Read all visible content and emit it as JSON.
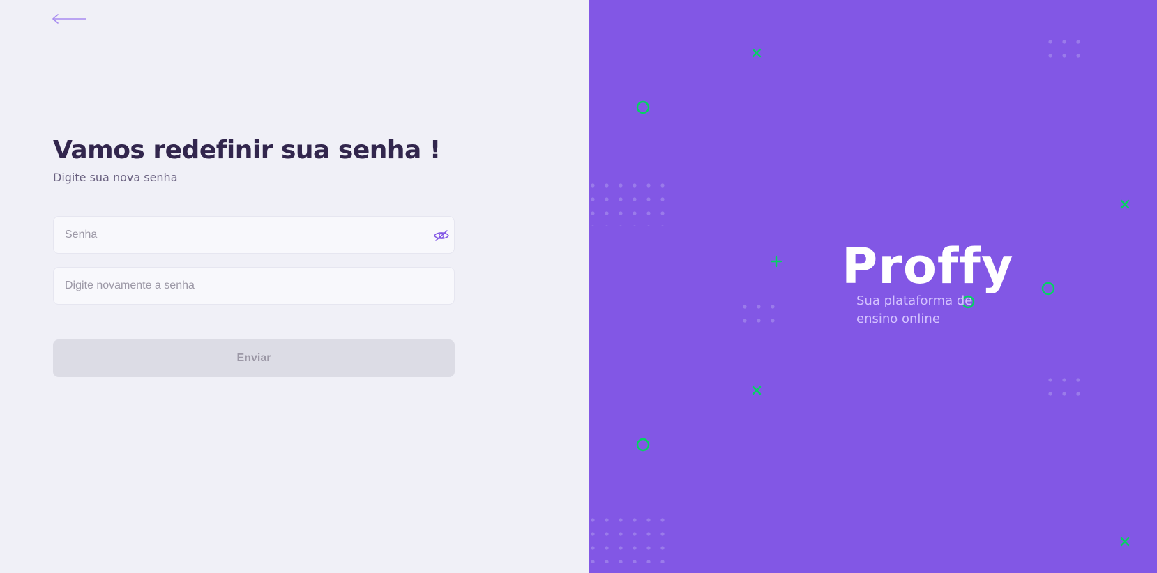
{
  "form": {
    "title": "Vamos redefinir sua senha !",
    "subtitle": "Digite sua nova senha",
    "password_placeholder": "Senha",
    "password_value": "",
    "confirm_placeholder": "Digite novamente a senha",
    "confirm_value": "",
    "submit_label": "Enviar",
    "back_icon": "arrow-left-icon",
    "eye_icon": "eye-off-icon"
  },
  "brand": {
    "logo": "Proffy",
    "tagline": "Sua plataforma de ensino online"
  },
  "colors": {
    "background": "#F0F0F7",
    "primary": "#8257E5",
    "accent": "#04D361",
    "title": "#32264D",
    "text": "#6A6180",
    "input_bg": "#F8F8FC",
    "button_disabled": "#DCDCE5",
    "tagline": "#D4C2FF"
  },
  "decorations": {
    "icons": [
      "x-icon",
      "circle-icon",
      "plus-icon",
      "dot-grid"
    ]
  }
}
